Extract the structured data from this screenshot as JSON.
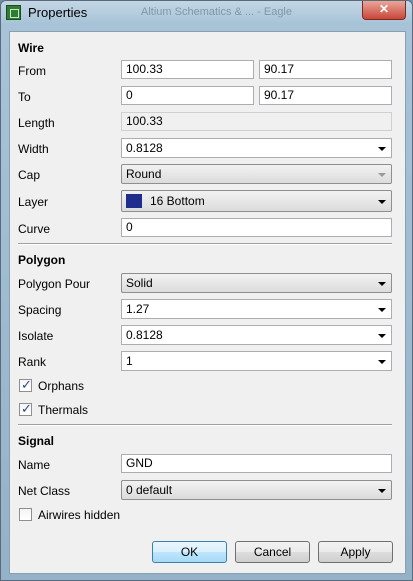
{
  "window": {
    "title": "Properties",
    "background_text": "Altium Schematics & ... - Eagle",
    "close_label": "✕"
  },
  "wire": {
    "section": "Wire",
    "from_label": "From",
    "from_x": "100.33",
    "from_y": "90.17",
    "to_label": "To",
    "to_x": "0",
    "to_y": "90.17",
    "length_label": "Length",
    "length_value": "100.33",
    "width_label": "Width",
    "width_value": "0.8128",
    "cap_label": "Cap",
    "cap_value": "Round",
    "layer_label": "Layer",
    "layer_value": "16 Bottom",
    "layer_color": "#1f2d8c",
    "curve_label": "Curve",
    "curve_value": "0"
  },
  "polygon": {
    "section": "Polygon",
    "pour_label": "Polygon Pour",
    "pour_value": "Solid",
    "spacing_label": "Spacing",
    "spacing_value": "1.27",
    "isolate_label": "Isolate",
    "isolate_value": "0.8128",
    "rank_label": "Rank",
    "rank_value": "1",
    "orphans_label": "Orphans",
    "orphans_checked": true,
    "thermals_label": "Thermals",
    "thermals_checked": true
  },
  "signal": {
    "section": "Signal",
    "name_label": "Name",
    "name_value": "GND",
    "netclass_label": "Net Class",
    "netclass_value": "0 default",
    "airwires_label": "Airwires hidden",
    "airwires_checked": false
  },
  "buttons": {
    "ok": "OK",
    "cancel": "Cancel",
    "apply": "Apply"
  }
}
